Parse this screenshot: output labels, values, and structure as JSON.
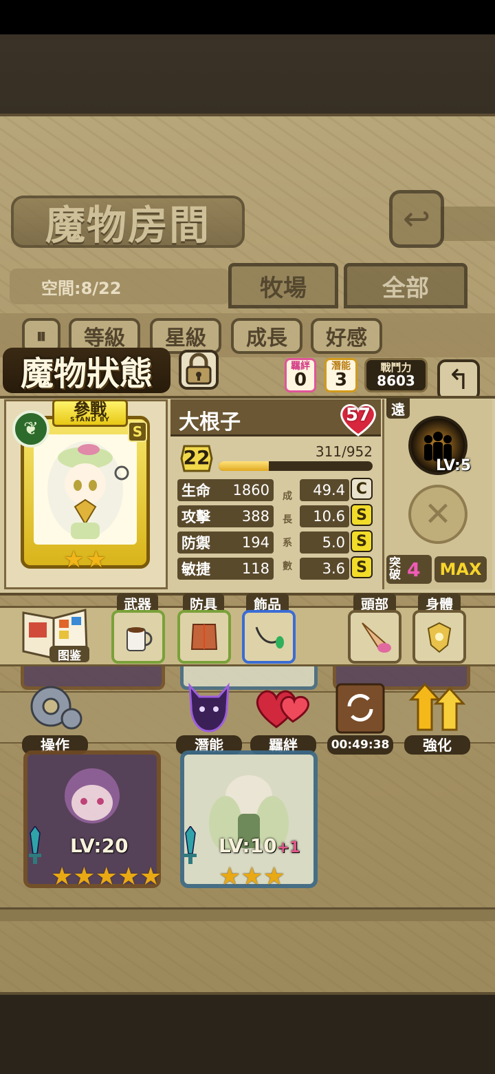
{
  "room": {
    "title": "魔物房間",
    "space_label": "空間:8/22",
    "tabs": [
      {
        "label": "牧場",
        "active": true
      },
      {
        "label": "全部",
        "active": false
      }
    ],
    "sort_buttons": [
      "等級",
      "星級",
      "成長",
      "好感"
    ]
  },
  "status": {
    "title": "魔物狀態",
    "bond": {
      "label": "羈絆",
      "value": "0"
    },
    "potential": {
      "label": "潛能",
      "value": "3"
    },
    "power": {
      "label": "戰鬥力",
      "value": "8603"
    },
    "banner": {
      "label": "參戰",
      "sub": "STAND BY"
    },
    "rank": "S",
    "stars": 2,
    "monster_name": "大根子",
    "affection": "57",
    "level": "22",
    "exp_text": "311/952",
    "exp_fraction": 0.327,
    "growth_labels": [
      "成",
      "長",
      "系",
      "數"
    ],
    "stats": [
      {
        "name": "生命",
        "value": "1860",
        "growth": "49.4",
        "grade": "C"
      },
      {
        "name": "攻擊",
        "value": "388",
        "growth": "10.6",
        "grade": "S"
      },
      {
        "name": "防禦",
        "value": "194",
        "growth": "5.0",
        "grade": "S"
      },
      {
        "name": "敏捷",
        "value": "118",
        "growth": "3.6",
        "grade": "S"
      }
    ],
    "range_tag": "遠",
    "skill_level": "LV:5",
    "breakthrough": {
      "label": "突破",
      "value": "4"
    },
    "max_label": "MAX"
  },
  "equipment": {
    "book_label": "图鉴",
    "slots": [
      {
        "label": "武器",
        "item": "mug-icon"
      },
      {
        "label": "防具",
        "item": "armor-icon"
      },
      {
        "label": "飾品",
        "item": "necklace-icon"
      },
      {
        "label": "頭部",
        "item": "hat-icon"
      },
      {
        "label": "身體",
        "item": "emblem-icon"
      }
    ]
  },
  "actions": [
    {
      "label": "操作",
      "icon": "gear-icon"
    },
    {
      "label": "潛能",
      "icon": "devil-icon"
    },
    {
      "label": "羈絆",
      "icon": "hearts-icon"
    },
    {
      "label": "00:49:38",
      "icon": "refresh-icon"
    },
    {
      "label": "強化",
      "icon": "up-arrows-icon"
    }
  ],
  "monster_cards": [
    {
      "level": "LV:20",
      "plus": "",
      "stars": 5
    },
    {
      "level": "LV:10",
      "plus": "+1",
      "stars": 3
    }
  ],
  "peek_levels": [
    "LV:20",
    "LV:10",
    "LV:10"
  ],
  "colors": {
    "accent_gold": "#f2dc2a",
    "bond_pink": "#e0559a",
    "potential_gold": "#d29a1c",
    "break_pink": "#f05bb6"
  }
}
